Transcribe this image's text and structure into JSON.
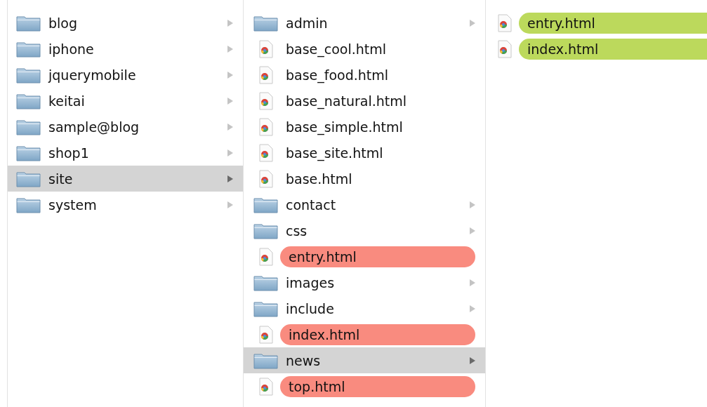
{
  "columns": [
    {
      "items": [
        {
          "kind": "folder",
          "name": "blog",
          "selected": false
        },
        {
          "kind": "folder",
          "name": "iphone",
          "selected": false
        },
        {
          "kind": "folder",
          "name": "jquerymobile",
          "selected": false
        },
        {
          "kind": "folder",
          "name": "keitai",
          "selected": false
        },
        {
          "kind": "folder",
          "name": "sample@blog",
          "selected": false
        },
        {
          "kind": "folder",
          "name": "shop1",
          "selected": false
        },
        {
          "kind": "folder",
          "name": "site",
          "selected": true
        },
        {
          "kind": "folder",
          "name": "system",
          "selected": false
        }
      ]
    },
    {
      "items": [
        {
          "kind": "folder",
          "name": "admin",
          "selected": false
        },
        {
          "kind": "file",
          "name": "base_cool.html",
          "selected": false
        },
        {
          "kind": "file",
          "name": "base_food.html",
          "selected": false
        },
        {
          "kind": "file",
          "name": "base_natural.html",
          "selected": false
        },
        {
          "kind": "file",
          "name": "base_simple.html",
          "selected": false
        },
        {
          "kind": "file",
          "name": "base_site.html",
          "selected": false
        },
        {
          "kind": "file",
          "name": "base.html",
          "selected": false
        },
        {
          "kind": "folder",
          "name": "contact",
          "selected": false
        },
        {
          "kind": "folder",
          "name": "css",
          "selected": false
        },
        {
          "kind": "file",
          "name": "entry.html",
          "selected": false,
          "color": "#f98b7f"
        },
        {
          "kind": "folder",
          "name": "images",
          "selected": false
        },
        {
          "kind": "folder",
          "name": "include",
          "selected": false
        },
        {
          "kind": "file",
          "name": "index.html",
          "selected": false,
          "color": "#f98b7f"
        },
        {
          "kind": "folder",
          "name": "news",
          "selected": true
        },
        {
          "kind": "file",
          "name": "top.html",
          "selected": false,
          "color": "#f98b7f"
        }
      ]
    },
    {
      "items": [
        {
          "kind": "file",
          "name": "entry.html",
          "selected": false,
          "color": "#bcd95c"
        },
        {
          "kind": "file",
          "name": "index.html",
          "selected": false,
          "color": "#bcd95c"
        }
      ]
    }
  ]
}
